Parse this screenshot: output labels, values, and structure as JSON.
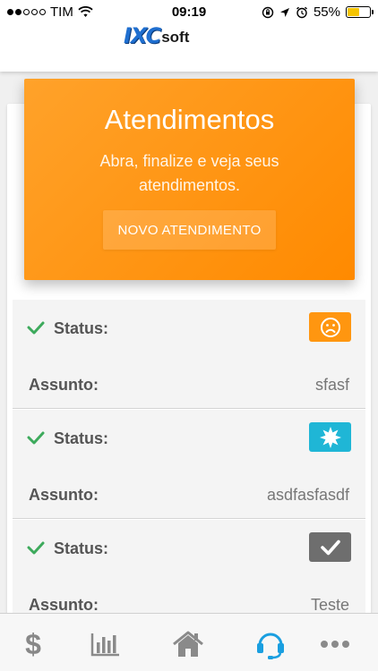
{
  "status_bar": {
    "carrier": "TIM",
    "time": "09:19",
    "battery": "55%",
    "battery_level": 0.55,
    "signal_bars": 2
  },
  "header": {
    "logo_main": "IXC",
    "logo_sub": "soft"
  },
  "hero": {
    "title": "Atendimentos",
    "subtitle": "Abra, finalize e veja seus atendimentos.",
    "button_label": "NOVO ATENDIMENTO"
  },
  "tickets": [
    {
      "status_label": "Status:",
      "status_icon": "sad-face-icon",
      "status_color": "#ff9610",
      "subject_label": "Assunto:",
      "subject": "sfasf"
    },
    {
      "status_label": "Status:",
      "status_icon": "starburst-icon",
      "status_color": "#1fb6d6",
      "subject_label": "Assunto:",
      "subject": "asdfasfasdf"
    },
    {
      "status_label": "Status:",
      "status_icon": "checkmark-icon",
      "status_color": "#6e6e6e",
      "subject_label": "Assunto:",
      "subject": "Teste"
    }
  ],
  "tabbar": {
    "tabs": [
      {
        "icon": "dollar-icon",
        "glyph": "$",
        "active": false
      },
      {
        "icon": "bar-chart-icon",
        "active": false
      },
      {
        "icon": "home-icon",
        "active": false
      },
      {
        "icon": "headset-icon",
        "active": true
      },
      {
        "icon": "more-icon",
        "active": false
      }
    ],
    "active_color": "#1a9fe0",
    "inactive_color": "#8a8a8a"
  }
}
